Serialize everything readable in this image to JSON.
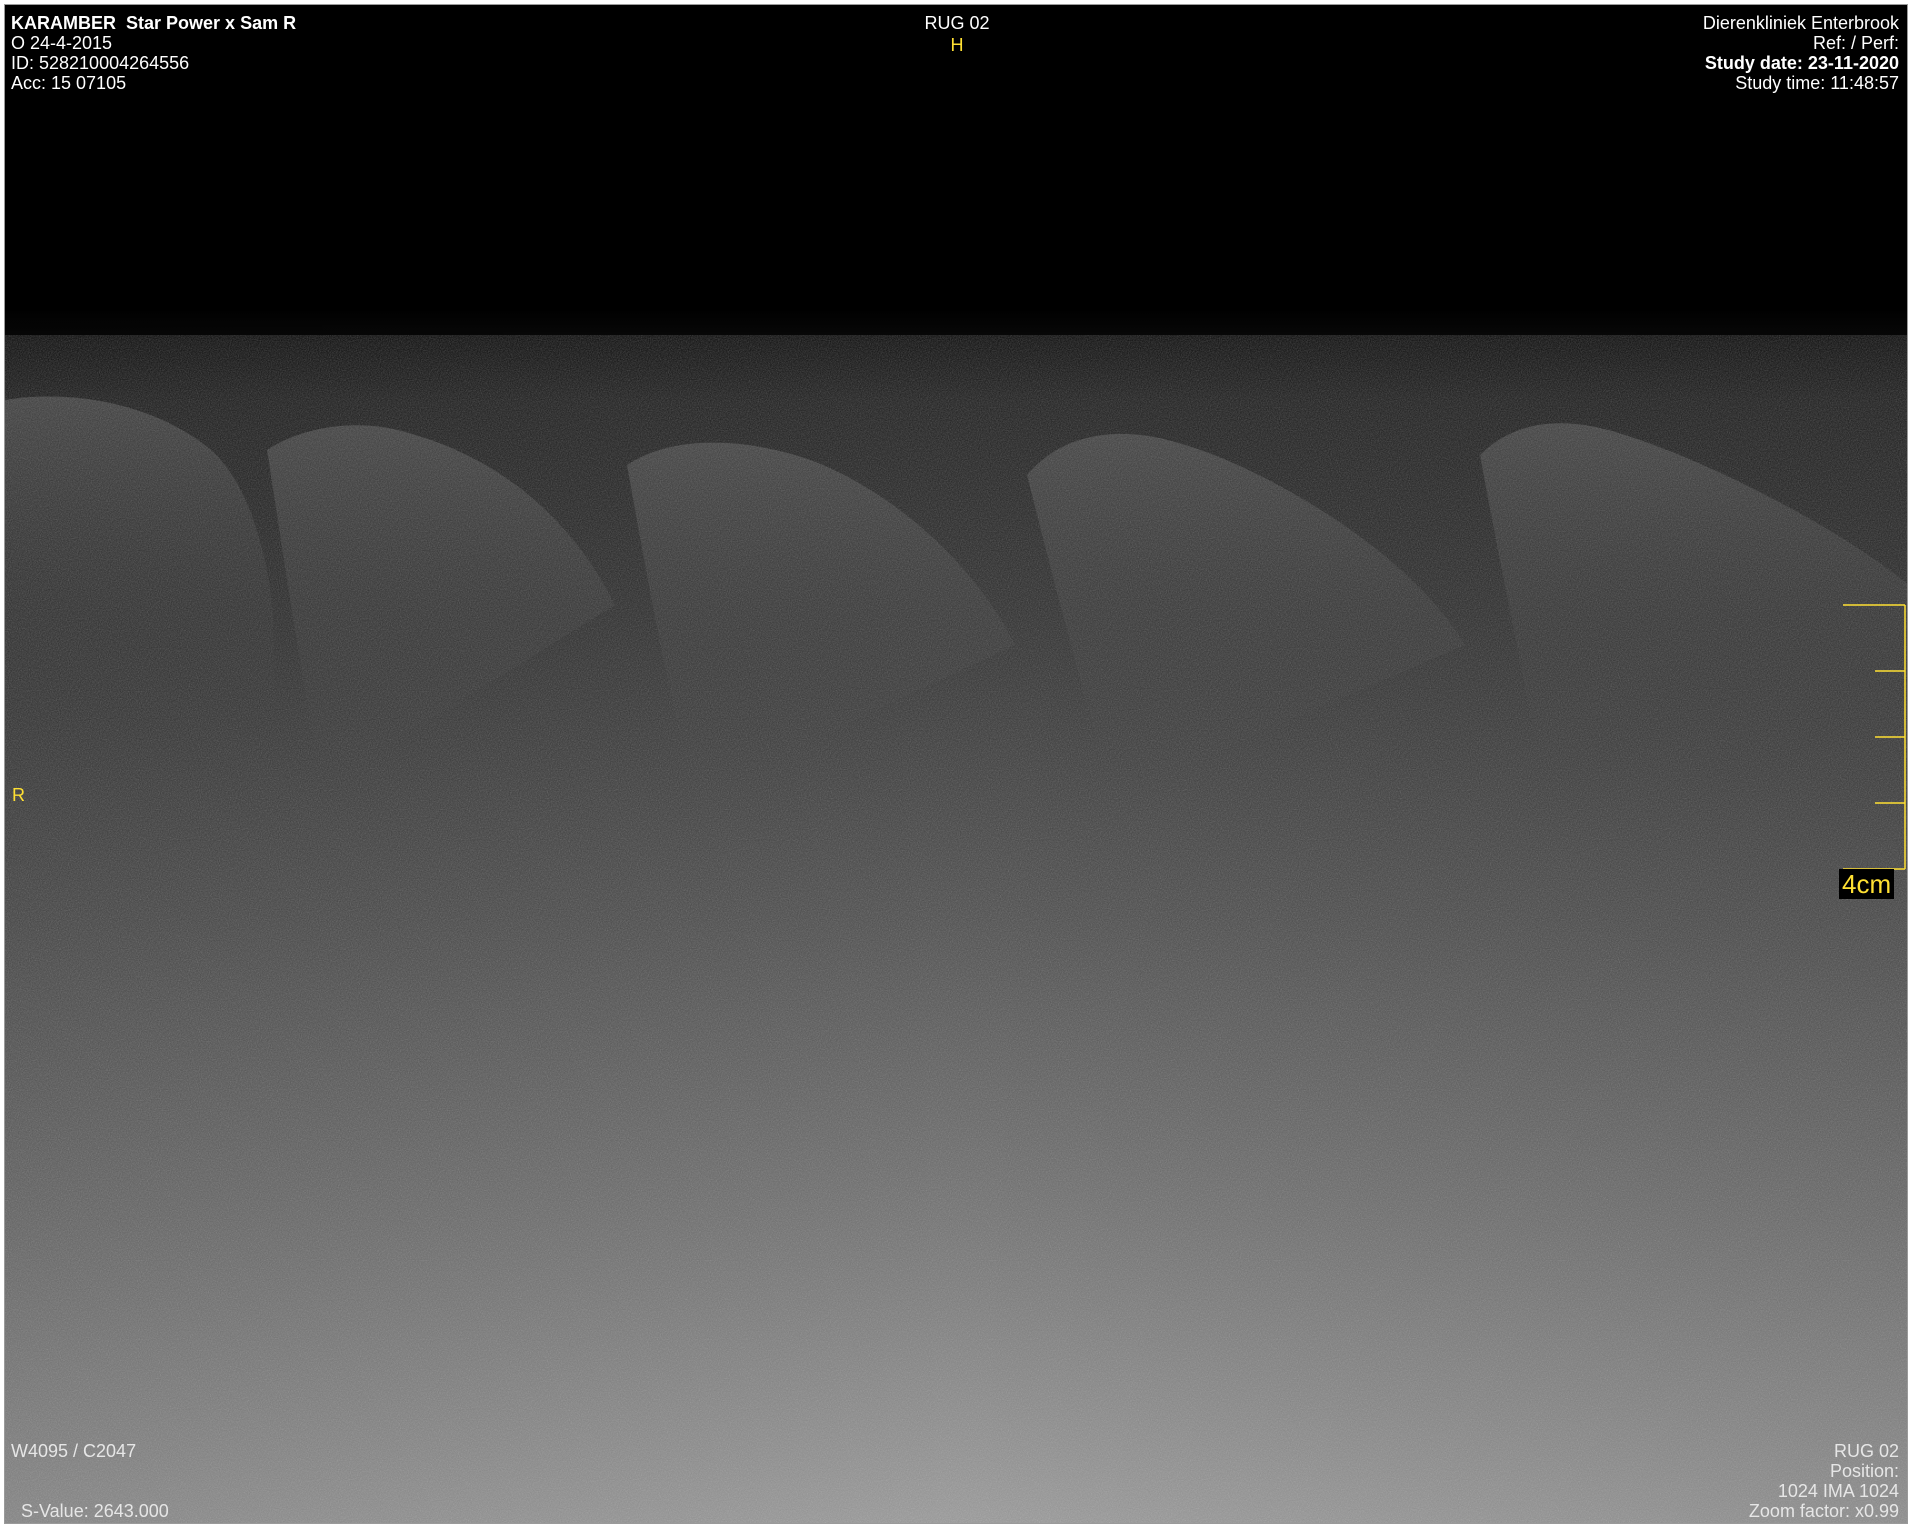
{
  "top_left": {
    "patient_name": "KARAMBER",
    "patient_desc": "Star Power x Sam R",
    "birth_line": "O  24-4-2015",
    "id_line": "ID: 528210004264556",
    "acc_line": "Acc: 15 07105"
  },
  "top_center": {
    "series_label": "RUG 02",
    "orientation_top": "H"
  },
  "top_right": {
    "institution": "Dierenkliniek Enterbrook",
    "ref_perf": "Ref:  / Perf:",
    "study_date": "Study date: 23-11-2020",
    "study_time": "Study time: 11:48:57"
  },
  "left_marker": "R",
  "scale": {
    "label": "4cm",
    "segments": 4,
    "color": "#ffe033"
  },
  "bottom_left": {
    "window_level": "W4095 / C2047",
    "s_value": "S-Value: 2643.000"
  },
  "bottom_right": {
    "series_label": "RUG 02",
    "position": "Position:",
    "image_info": "1024 IMA 1024",
    "zoom": "Zoom factor: x0.99"
  },
  "colors": {
    "overlay_text": "#ffffff",
    "marker": "#ffe033",
    "background": "#000000"
  }
}
